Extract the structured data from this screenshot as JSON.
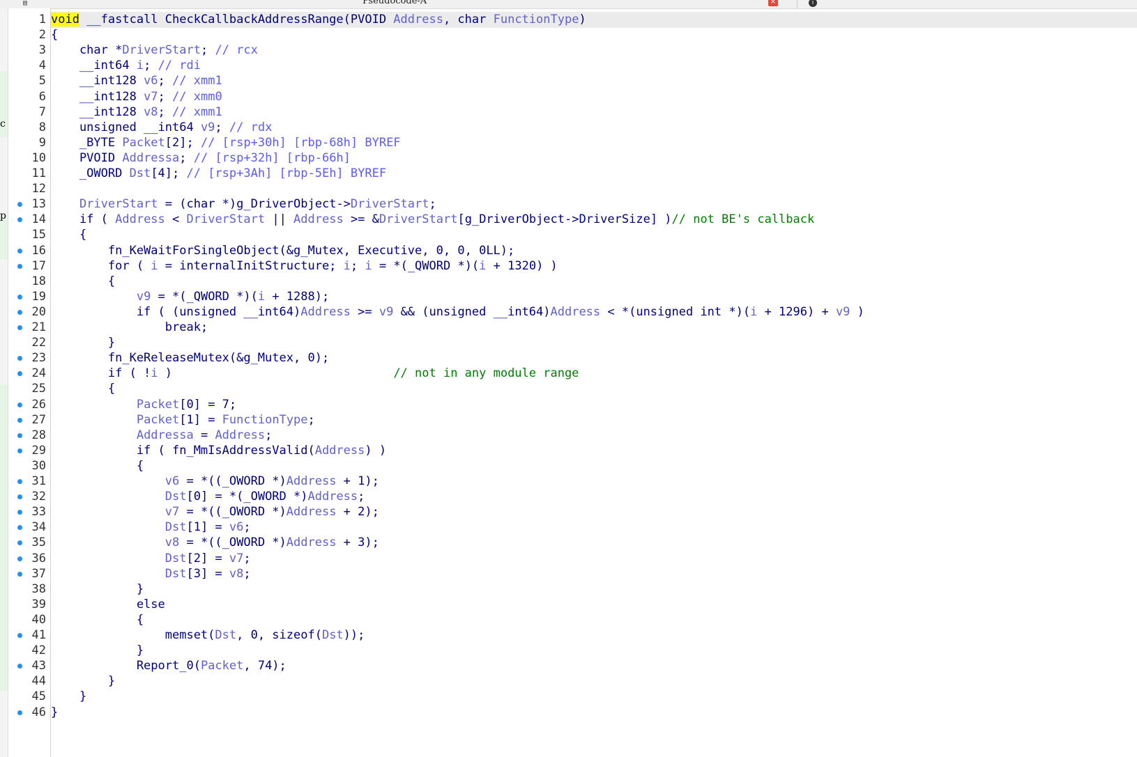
{
  "window": {
    "tab_title": "Pseudocode-A",
    "close_glyph": "×",
    "info_glyph": "i"
  },
  "left_strip": {
    "chars": [
      "c",
      "p"
    ]
  },
  "colors": {
    "keyword": "#000080",
    "variable": "#6060d0",
    "comment_gray": "#5a5aff",
    "comment_green": "#008000",
    "breakpoint_dot": "#1e90ff",
    "cursor_highlight": "#ffff00"
  },
  "code": {
    "lines": [
      {
        "n": "1",
        "dot": false,
        "text": "void __fastcall CheckCallbackAddressRange(PVOID Address, char FunctionType)"
      },
      {
        "n": "2",
        "dot": false,
        "text": "{"
      },
      {
        "n": "3",
        "dot": false,
        "text": "    char *DriverStart; // rcx"
      },
      {
        "n": "4",
        "dot": false,
        "text": "    __int64 i; // rdi"
      },
      {
        "n": "5",
        "dot": false,
        "text": "    __int128 v6; // xmm1"
      },
      {
        "n": "6",
        "dot": false,
        "text": "    __int128 v7; // xmm0"
      },
      {
        "n": "7",
        "dot": false,
        "text": "    __int128 v8; // xmm1"
      },
      {
        "n": "8",
        "dot": false,
        "text": "    unsigned __int64 v9; // rdx"
      },
      {
        "n": "9",
        "dot": false,
        "text": "    _BYTE Packet[2]; // [rsp+30h] [rbp-68h] BYREF"
      },
      {
        "n": "10",
        "dot": false,
        "text": "    PVOID Addressa; // [rsp+32h] [rbp-66h]"
      },
      {
        "n": "11",
        "dot": false,
        "text": "    _OWORD Dst[4]; // [rsp+3Ah] [rbp-5Eh] BYREF"
      },
      {
        "n": "12",
        "dot": false,
        "text": ""
      },
      {
        "n": "13",
        "dot": true,
        "text": "    DriverStart = (char *)g_DriverObject->DriverStart;"
      },
      {
        "n": "14",
        "dot": true,
        "text": "    if ( Address < DriverStart || Address >= &DriverStart[g_DriverObject->DriverSize] )// not BE's callback"
      },
      {
        "n": "15",
        "dot": false,
        "text": "    {"
      },
      {
        "n": "16",
        "dot": true,
        "text": "        fn_KeWaitForSingleObject(&g_Mutex, Executive, 0, 0, 0LL);"
      },
      {
        "n": "17",
        "dot": true,
        "text": "        for ( i = internalInitStructure; i; i = *(_QWORD *)(i + 1320) )"
      },
      {
        "n": "18",
        "dot": false,
        "text": "        {"
      },
      {
        "n": "19",
        "dot": true,
        "text": "            v9 = *(_QWORD *)(i + 1288);"
      },
      {
        "n": "20",
        "dot": true,
        "text": "            if ( (unsigned __int64)Address >= v9 && (unsigned __int64)Address < *(unsigned int *)(i + 1296) + v9 )"
      },
      {
        "n": "21",
        "dot": true,
        "text": "                break;"
      },
      {
        "n": "22",
        "dot": false,
        "text": "        }"
      },
      {
        "n": "23",
        "dot": true,
        "text": "        fn_KeReleaseMutex(&g_Mutex, 0);"
      },
      {
        "n": "24",
        "dot": true,
        "text": "        if ( !i )                               // not in any module range"
      },
      {
        "n": "25",
        "dot": false,
        "text": "        {"
      },
      {
        "n": "26",
        "dot": true,
        "text": "            Packet[0] = 7;"
      },
      {
        "n": "27",
        "dot": true,
        "text": "            Packet[1] = FunctionType;"
      },
      {
        "n": "28",
        "dot": true,
        "text": "            Addressa = Address;"
      },
      {
        "n": "29",
        "dot": true,
        "text": "            if ( fn_MmIsAddressValid(Address) )"
      },
      {
        "n": "30",
        "dot": false,
        "text": "            {"
      },
      {
        "n": "31",
        "dot": true,
        "text": "                v6 = *((_OWORD *)Address + 1);"
      },
      {
        "n": "32",
        "dot": true,
        "text": "                Dst[0] = *(_OWORD *)Address;"
      },
      {
        "n": "33",
        "dot": true,
        "text": "                v7 = *((_OWORD *)Address + 2);"
      },
      {
        "n": "34",
        "dot": true,
        "text": "                Dst[1] = v6;"
      },
      {
        "n": "35",
        "dot": true,
        "text": "                v8 = *((_OWORD *)Address + 3);"
      },
      {
        "n": "36",
        "dot": true,
        "text": "                Dst[2] = v7;"
      },
      {
        "n": "37",
        "dot": true,
        "text": "                Dst[3] = v8;"
      },
      {
        "n": "38",
        "dot": false,
        "text": "            }"
      },
      {
        "n": "39",
        "dot": false,
        "text": "            else"
      },
      {
        "n": "40",
        "dot": false,
        "text": "            {"
      },
      {
        "n": "41",
        "dot": true,
        "text": "                memset(Dst, 0, sizeof(Dst));"
      },
      {
        "n": "42",
        "dot": false,
        "text": "            }"
      },
      {
        "n": "43",
        "dot": true,
        "text": "            Report_0(Packet, 74);"
      },
      {
        "n": "44",
        "dot": false,
        "text": "        }"
      },
      {
        "n": "45",
        "dot": false,
        "text": "    }"
      },
      {
        "n": "46",
        "dot": true,
        "text": "}"
      }
    ]
  }
}
